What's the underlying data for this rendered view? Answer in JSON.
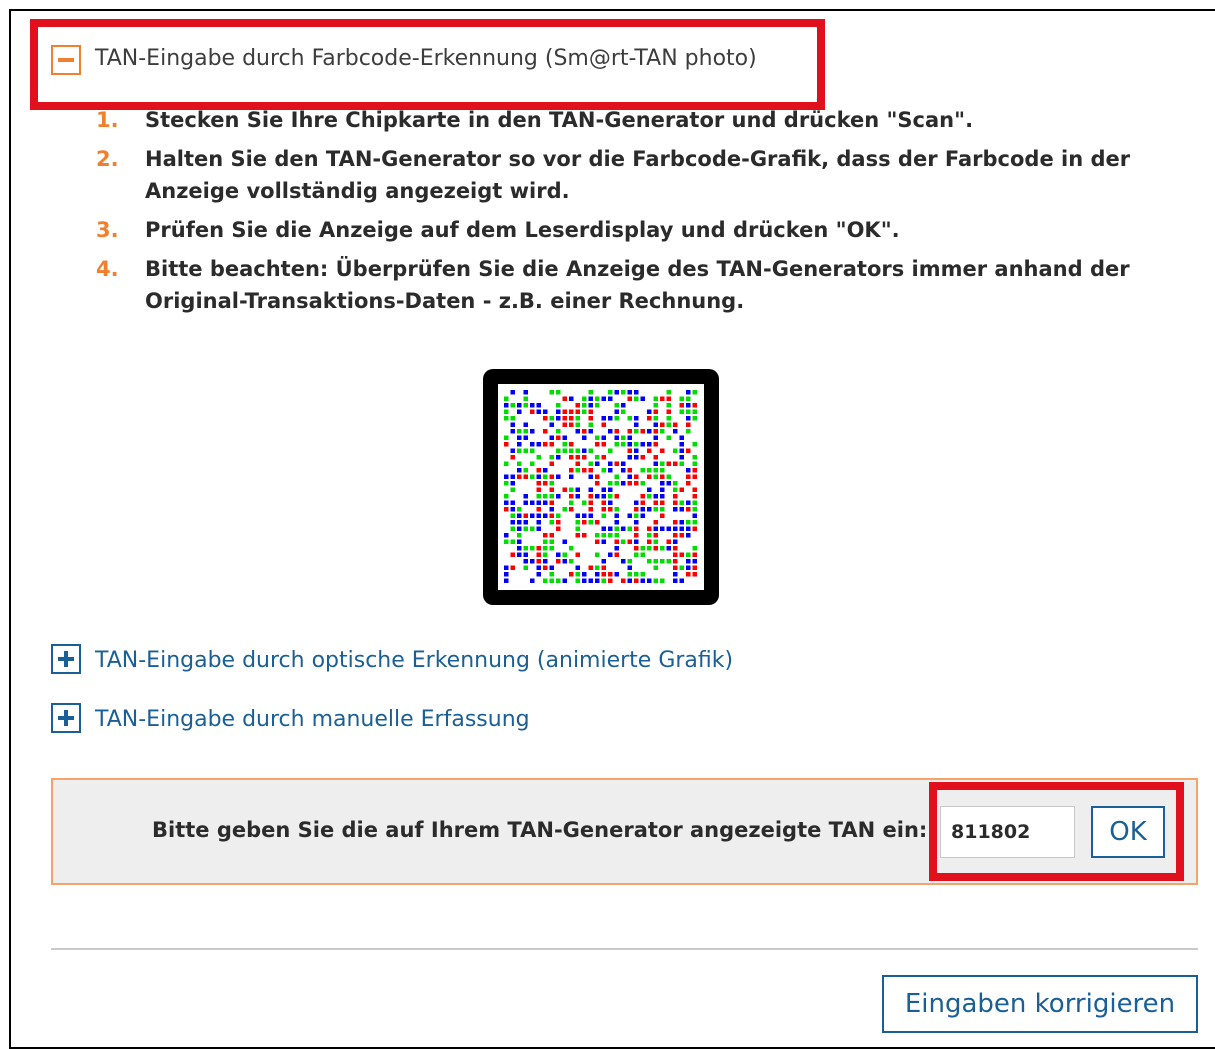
{
  "section_active": {
    "title": "TAN-Eingabe durch Farbcode-Erkennung (Sm@rt-TAN photo)",
    "icon": "minus-icon",
    "steps": [
      {
        "num": "1.",
        "text": "Stecken Sie Ihre Chipkarte in den TAN-Generator und drücken \"Scan\"."
      },
      {
        "num": "2.",
        "text": "Halten Sie den TAN-Generator so vor die Farbcode-Grafik, dass der Farbcode in der Anzeige vollständig angezeigt wird."
      },
      {
        "num": "3.",
        "text": "Prüfen Sie die Anzeige auf dem Leserdisplay und drücken \"OK\"."
      },
      {
        "num": "4.",
        "text": "Bitte beachten: Überprüfen Sie die Anzeige des TAN-Generators immer anhand der Original-Transaktions-Daten - z.B. einer Rechnung."
      }
    ]
  },
  "color_code": {
    "colors": [
      "#0000ff",
      "#ff0000",
      "#00dd00"
    ]
  },
  "sections_collapsed": [
    {
      "title": "TAN-Eingabe durch optische Erkennung (animierte Grafik)",
      "icon": "plus-icon"
    },
    {
      "title": "TAN-Eingabe durch manuelle Erfassung",
      "icon": "plus-icon"
    }
  ],
  "tan_entry": {
    "label": "Bitte geben Sie die auf Ihrem TAN-Generator angezeigte TAN ein:",
    "value": "811802",
    "ok_label": "OK"
  },
  "footer": {
    "correct_label": "Eingaben korrigieren"
  },
  "colors": {
    "accent_orange": "#f08030",
    "link_blue": "#1a5f95",
    "highlight_red": "#e0101c",
    "panel_bg": "#eeeeee"
  }
}
